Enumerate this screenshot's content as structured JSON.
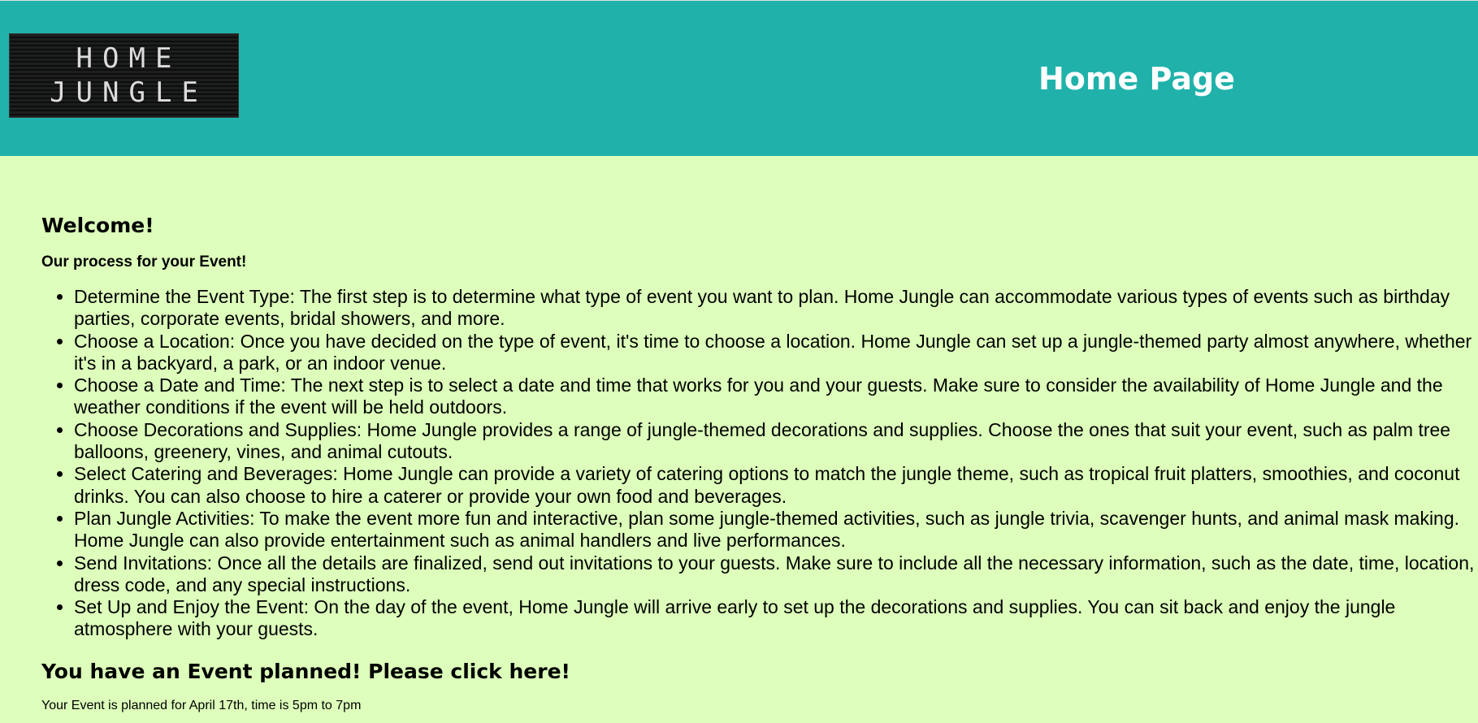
{
  "header": {
    "logo_lines": [
      "HOME",
      "JUNGLE"
    ],
    "title": "Home Page"
  },
  "main": {
    "welcome": "Welcome!",
    "process_heading": "Our process for your Event!",
    "steps": [
      "Determine the Event Type: The first step is to determine what type of event you want to plan. Home Jungle can accommodate various types of events such as birthday parties, corporate events, bridal showers, and more.",
      "Choose a Location: Once you have decided on the type of event, it's time to choose a location. Home Jungle can set up a jungle-themed party almost anywhere, whether it's in a backyard, a park, or an indoor venue.",
      "Choose a Date and Time: The next step is to select a date and time that works for you and your guests. Make sure to consider the availability of Home Jungle and the weather conditions if the event will be held outdoors.",
      "Choose Decorations and Supplies: Home Jungle provides a range of jungle-themed decorations and supplies. Choose the ones that suit your event, such as palm tree balloons, greenery, vines, and animal cutouts.",
      "Select Catering and Beverages: Home Jungle can provide a variety of catering options to match the jungle theme, such as tropical fruit platters, smoothies, and coconut drinks. You can also choose to hire a caterer or provide your own food and beverages.",
      "Plan Jungle Activities: To make the event more fun and interactive, plan some jungle-themed activities, such as jungle trivia, scavenger hunts, and animal mask making. Home Jungle can also provide entertainment such as animal handlers and live performances.",
      "Send Invitations: Once all the details are finalized, send out invitations to your guests. Make sure to include all the necessary information, such as the date, time, location, dress code, and any special instructions.",
      "Set Up and Enjoy the Event: On the day of the event, Home Jungle will arrive early to set up the decorations and supplies. You can sit back and enjoy the jungle atmosphere with your guests."
    ],
    "cta": "You have an Event planned! Please click here!",
    "planned_text": "Your Event is planned for April 17th, time is 5pm to 7pm"
  },
  "colors": {
    "header_bg": "#20b2aa",
    "page_bg": "#ddffbb",
    "title_text": "#ffffff"
  }
}
